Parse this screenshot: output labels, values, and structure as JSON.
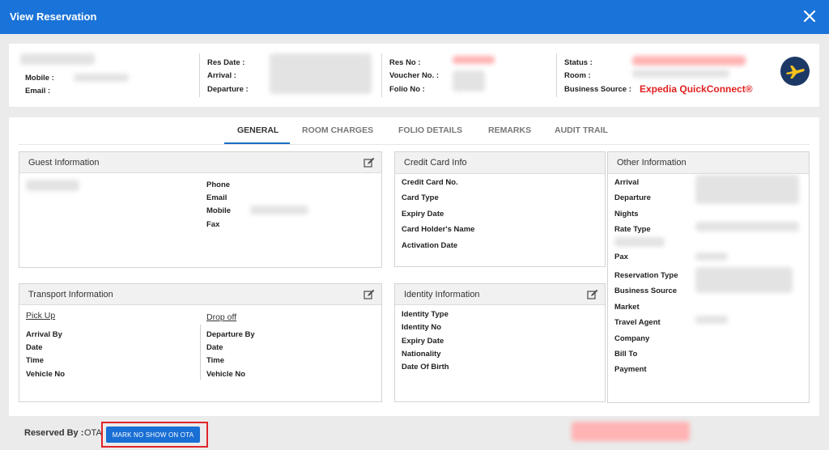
{
  "window": {
    "title": "View Reservation"
  },
  "summary": {
    "mobile_label": "Mobile :",
    "email_label": "Email :",
    "res_date_label": "Res Date :",
    "arrival_label": "Arrival :",
    "departure_label": "Departure :",
    "res_no_label": "Res No :",
    "voucher_label": "Voucher No. :",
    "folio_label": "Folio No :",
    "status_label": "Status :",
    "room_label": "Room :",
    "business_source_label": "Business Source :",
    "business_source_value": "Expedia QuickConnect®"
  },
  "tabs": [
    {
      "label": "GENERAL",
      "active": true
    },
    {
      "label": "ROOM CHARGES",
      "active": false
    },
    {
      "label": "FOLIO DETAILS",
      "active": false
    },
    {
      "label": "REMARKS",
      "active": false
    },
    {
      "label": "AUDIT TRAIL",
      "active": false
    }
  ],
  "guest": {
    "title": "Guest Information",
    "fields": [
      "Phone",
      "Email",
      "Mobile",
      "Fax"
    ]
  },
  "credit_card": {
    "title": "Credit Card Info",
    "fields": [
      "Credit Card No.",
      "Card Type",
      "Expiry Date",
      "Card Holder's Name",
      "Activation Date"
    ]
  },
  "other": {
    "title": "Other Information",
    "fields": [
      "Arrival",
      "Departure",
      "Nights",
      "Rate Type",
      "Pax",
      "Reservation Type",
      "Business Source",
      "Market",
      "Travel Agent",
      "Company",
      "Bill To",
      "Payment"
    ]
  },
  "transport": {
    "title": "Transport Information",
    "pickup_label": "Pick Up",
    "dropoff_label": "Drop off",
    "pickup_fields": [
      "Arrival By",
      "Date",
      "Time",
      "Vehicle No"
    ],
    "dropoff_fields": [
      "Departure By",
      "Date",
      "Time",
      "Vehicle No"
    ]
  },
  "identity": {
    "title": "Identity Information",
    "fields": [
      "Identity Type",
      "Identity No",
      "Expiry Date",
      "Nationality",
      "Date Of Birth"
    ]
  },
  "footer": {
    "reserved_by_label": "Reserved By :",
    "reserved_by_value": "OTA",
    "button_label": "MARK NO SHOW ON OTA"
  },
  "colors": {
    "header_bg": "#1a73d8",
    "accent": "#1a6fc4",
    "business_source": "#e02020",
    "highlight": "#e0242a"
  },
  "icons": {
    "close": "close-icon",
    "edit": "edit-icon",
    "logo": "expedia-logo-icon"
  }
}
